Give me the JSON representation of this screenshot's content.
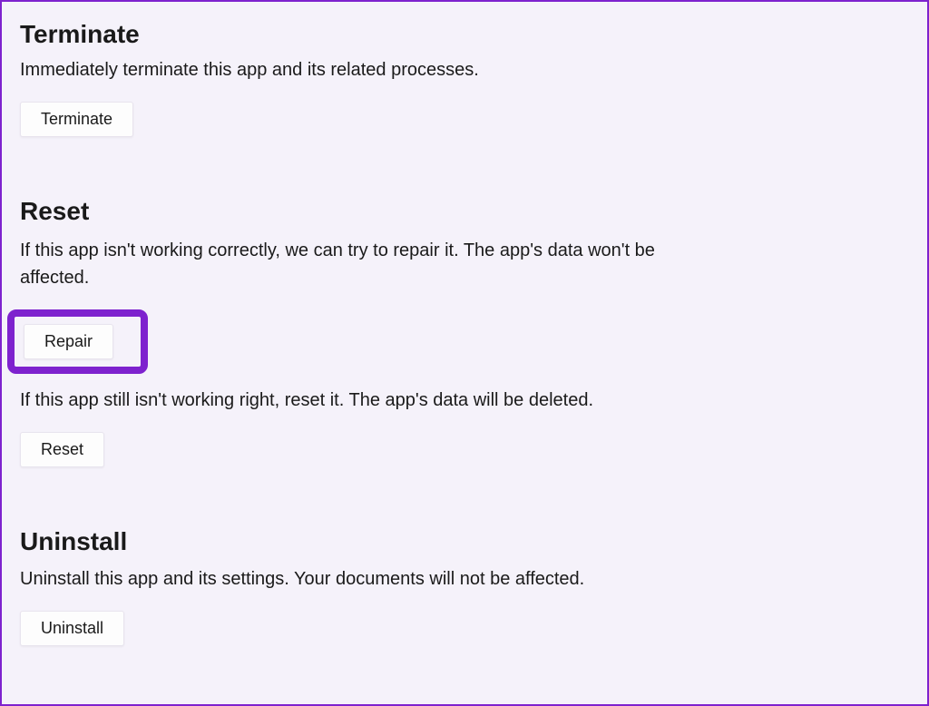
{
  "terminate": {
    "title": "Terminate",
    "description": "Immediately terminate this app and its related processes.",
    "button_label": "Terminate"
  },
  "reset": {
    "title": "Reset",
    "repair_description": "If this app isn't working correctly, we can try to repair it. The app's data won't be affected.",
    "repair_button_label": "Repair",
    "reset_description": "If this app still isn't working right, reset it. The app's data will be deleted.",
    "reset_button_label": "Reset"
  },
  "uninstall": {
    "title": "Uninstall",
    "description": "Uninstall this app and its settings. Your documents will not be affected.",
    "button_label": "Uninstall"
  },
  "highlight": {
    "target": "repair-button",
    "color": "#7e22ce"
  }
}
